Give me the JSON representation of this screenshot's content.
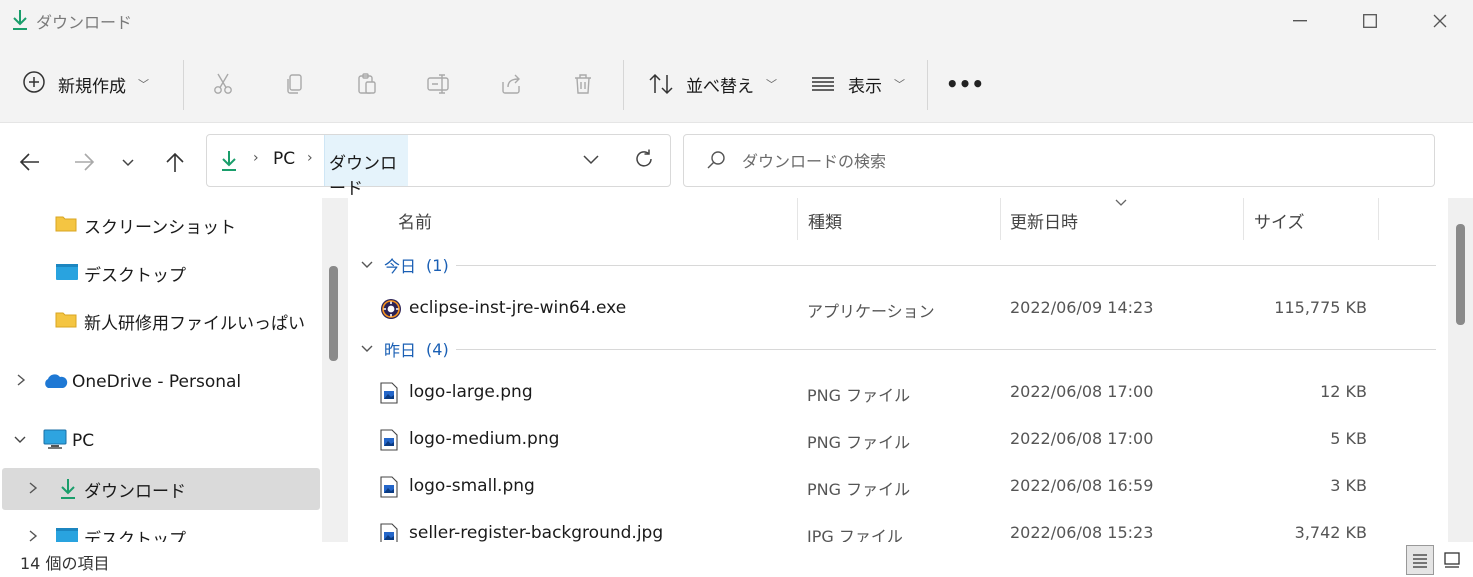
{
  "window": {
    "title": "ダウンロード"
  },
  "toolbar": {
    "new_label": "新規作成",
    "sort_label": "並べ替え",
    "view_label": "表示",
    "more_label": "•••"
  },
  "address": {
    "crumbs": [
      "PC",
      "ダウンロード"
    ]
  },
  "search": {
    "placeholder": "ダウンロードの検索"
  },
  "nav": {
    "items": [
      {
        "label": "スクリーンショット",
        "icon": "folder-icon"
      },
      {
        "label": "デスクトップ",
        "icon": "desktop-folder-icon"
      },
      {
        "label": "新人研修用ファイルいっぱい",
        "icon": "folder-icon"
      },
      {
        "label": "OneDrive - Personal",
        "icon": "onedrive-icon"
      },
      {
        "label": "PC",
        "icon": "pc-icon"
      },
      {
        "label": "ダウンロード",
        "icon": "download-icon"
      },
      {
        "label": "デスクトップ",
        "icon": "desktop-folder-icon"
      }
    ]
  },
  "columns": {
    "name": "名前",
    "type": "種類",
    "date": "更新日時",
    "size": "サイズ"
  },
  "groups": [
    {
      "label": "今日",
      "count": "(1)",
      "files": [
        {
          "name": "eclipse-inst-jre-win64.exe",
          "type": "アプリケーション",
          "date": "2022/06/09 14:23",
          "size": "115,775 KB",
          "icon": "eclipse-installer-icon"
        }
      ]
    },
    {
      "label": "昨日",
      "count": "(4)",
      "files": [
        {
          "name": "logo-large.png",
          "type": "PNG ファイル",
          "date": "2022/06/08 17:00",
          "size": "12 KB",
          "icon": "image-file-icon"
        },
        {
          "name": "logo-medium.png",
          "type": "PNG ファイル",
          "date": "2022/06/08 17:00",
          "size": "5 KB",
          "icon": "image-file-icon"
        },
        {
          "name": "logo-small.png",
          "type": "PNG ファイル",
          "date": "2022/06/08 16:59",
          "size": "3 KB",
          "icon": "image-file-icon"
        },
        {
          "name": "seller-register-background.jpg",
          "type": "JPG ファイル",
          "date": "2022/06/08 15:23",
          "size": "3,742 KB",
          "icon": "image-file-icon"
        }
      ]
    }
  ],
  "status": {
    "count_text": "14 個の項目"
  },
  "colors": {
    "accent_green": "#1a9e6b",
    "group_blue": "#1a5fb4",
    "folder_yellow": "#f4c542",
    "selected_bg": "#dadada"
  }
}
